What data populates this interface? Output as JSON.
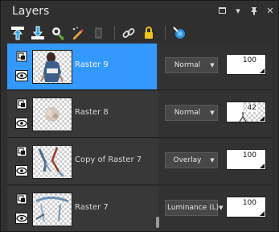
{
  "panel": {
    "title": "Layers"
  },
  "colors": {
    "selected": "#3399ff",
    "panel_bg": "#2f2f2f",
    "row_bg": "#383838"
  },
  "toolbar": {
    "icons": [
      "new-raster-layer-icon",
      "new-mask-layer-icon",
      "effects-icon",
      "paint-icon",
      "disabled-icon",
      "link-icon",
      "lock-icon",
      "palette-icon"
    ]
  },
  "layers": [
    {
      "name": "Raster 9",
      "blend_mode": "Normal",
      "opacity": "100",
      "opacity_level": 100,
      "selected": true
    },
    {
      "name": "Raster 8",
      "blend_mode": "Normal",
      "opacity": "42",
      "opacity_level": 42,
      "selected": false
    },
    {
      "name": "Copy of Raster 7",
      "blend_mode": "Overlay",
      "opacity": "100",
      "opacity_level": 100,
      "selected": false
    },
    {
      "name": "Raster 7",
      "blend_mode": "Luminance (L)",
      "opacity": "100",
      "opacity_level": 100,
      "selected": false
    }
  ]
}
